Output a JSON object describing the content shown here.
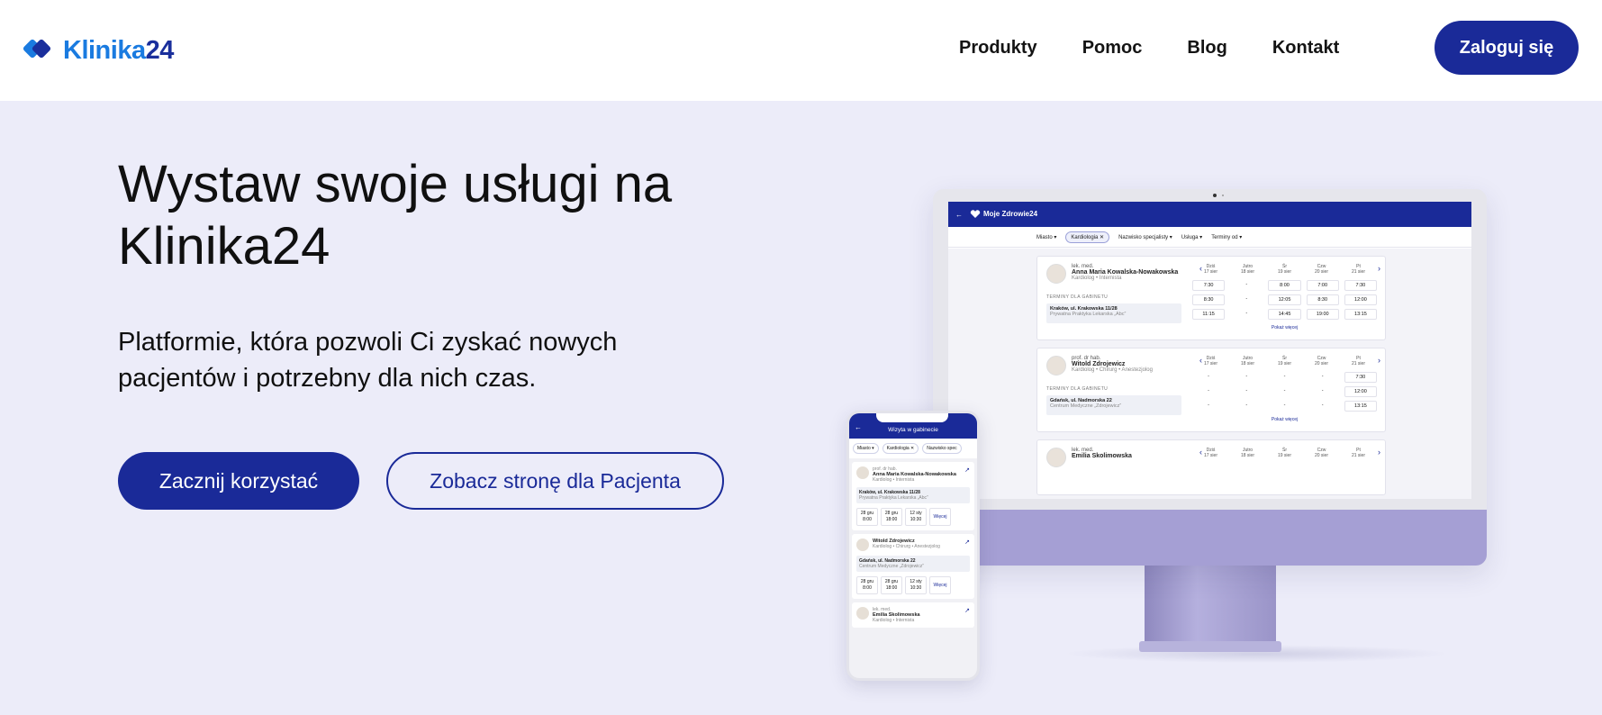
{
  "header": {
    "logo_text_a": "Klinika",
    "logo_text_b": "24",
    "nav": [
      "Produkty",
      "Pomoc",
      "Blog",
      "Kontakt"
    ],
    "login_label": "Zaloguj się"
  },
  "hero": {
    "title": "Wystaw swoje usługi na Klinika24",
    "subtitle": "Platformie, która pozwoli Ci zyskać nowych pacjentów i potrzebny dla nich czas.",
    "primary_cta": "Zacznij korzystać",
    "secondary_cta": "Zobacz stronę dla Pacjenta"
  },
  "desktop_app": {
    "brand": "Moje Zdrowie24",
    "filters": [
      "Miasto",
      "Kardiologia",
      "Nazwisko specjalisty",
      "Usługa",
      "Terminy od"
    ],
    "section_label": "TERMINY DLA GABINETU",
    "show_more": "Pokaż więcej",
    "days": [
      {
        "d": "Dziś",
        "date": "17 sier"
      },
      {
        "d": "Jutro",
        "date": "18 sier"
      },
      {
        "d": "Śr",
        "date": "19 sier"
      },
      {
        "d": "Czw",
        "date": "20 sier"
      },
      {
        "d": "Pt",
        "date": "21 sier"
      }
    ],
    "doctors": [
      {
        "title": "lek. med.",
        "name": "Anna Maria Kowalska-Nowakowska",
        "spec": "Kardiolog • Internista",
        "address": "Kraków, ul. Krakowska 11/28",
        "clinic": "Prywatna Praktyka Lekarska „Abc”",
        "slots": [
          "7:30",
          "-",
          "8:00",
          "7:00",
          "7:30",
          "8:30",
          "-",
          "12:05",
          "8:30",
          "12:00",
          "11:15",
          "-",
          "14:45",
          "19:00",
          "13:15"
        ]
      },
      {
        "title": "prof. dr hab.",
        "name": "Witold Zdrojewicz",
        "spec": "Kardiolog • Chirurg • Anestezjolog",
        "address": "Gdańsk, ul. Nadmorska 22",
        "clinic": "Centrum Medyczne „Zdrojewicz”",
        "slots": [
          "-",
          "-",
          "-",
          "-",
          "7:30",
          "-",
          "-",
          "-",
          "-",
          "12:00",
          "-",
          "-",
          "-",
          "-",
          "13:15"
        ]
      },
      {
        "title": "lek. med.",
        "name": "Emilia Skolimowska",
        "spec": "",
        "address": "",
        "clinic": "",
        "slots": []
      }
    ]
  },
  "mobile_app": {
    "title": "Wizyta w gabinecie",
    "filters": [
      "Miasto",
      "Kardiologia",
      "Nazwisko spec"
    ],
    "more_label": "Więcej",
    "doctors": [
      {
        "title": "prof. dr hab.",
        "name": "Anna Maria Kowalska-Nowakowska",
        "spec": "Kardiolog • Internista",
        "address": "Kraków, ul. Krakowska 11/28",
        "clinic": "Prywatna Praktyka Lekarska „Abc”",
        "slots": [
          {
            "d": "28 gru",
            "t": "8:00"
          },
          {
            "d": "28 gru",
            "t": "18:00"
          },
          {
            "d": "12 sty",
            "t": "10:30"
          }
        ]
      },
      {
        "title": "",
        "name": "Witold Zdrojewicz",
        "spec": "Kardiolog • Chirurg • Anestezjolog",
        "address": "Gdańsk, ul. Nadmorska 22",
        "clinic": "Centrum Medyczne „Zdrojewicz”",
        "slots": [
          {
            "d": "28 gru",
            "t": "8:00"
          },
          {
            "d": "28 gru",
            "t": "18:00"
          },
          {
            "d": "12 sty",
            "t": "10:30"
          }
        ]
      },
      {
        "title": "lek. med.",
        "name": "Emilia Skolimowska",
        "spec": "Kardiolog • Internista"
      }
    ]
  },
  "colors": {
    "brand_navy": "#1a2a98",
    "brand_blue": "#1a7be0",
    "hero_bg": "#ececf9",
    "monitor_accent": "#a59fd4"
  }
}
